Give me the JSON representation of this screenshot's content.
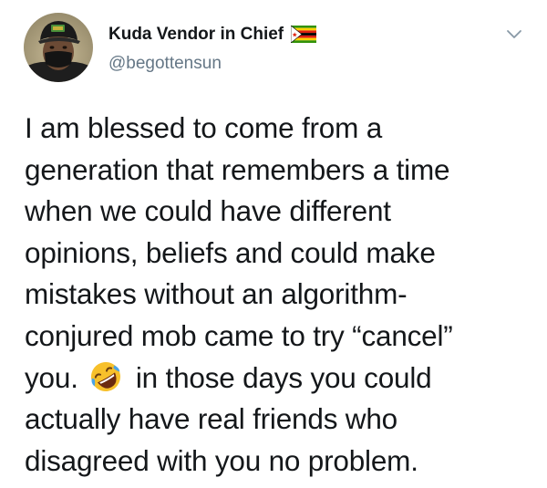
{
  "tweet": {
    "author": {
      "display_name": "Kuda Vendor in Chief",
      "handle": "@begottensun",
      "avatar_icon": "profile-photo-avatar",
      "flag_icon": "zimbabwe-flag-icon"
    },
    "menu_icon": "chevron-down-icon",
    "text_lines": [
      "I am blessed to come from a",
      "generation that remembers a time",
      "when we could have different",
      "opinions, beliefs and could make",
      "mistakes without an algorithm-",
      "conjured mob came to try “cancel”",
      {
        "before": "you.",
        "emoji": "rolling-on-floor-laughing-emoji",
        "after": "in those days you could"
      },
      "actually have real friends who",
      "disagreed with you no problem."
    ]
  },
  "colors": {
    "text": "#14171a",
    "secondary": "#657786",
    "background": "#ffffff"
  }
}
